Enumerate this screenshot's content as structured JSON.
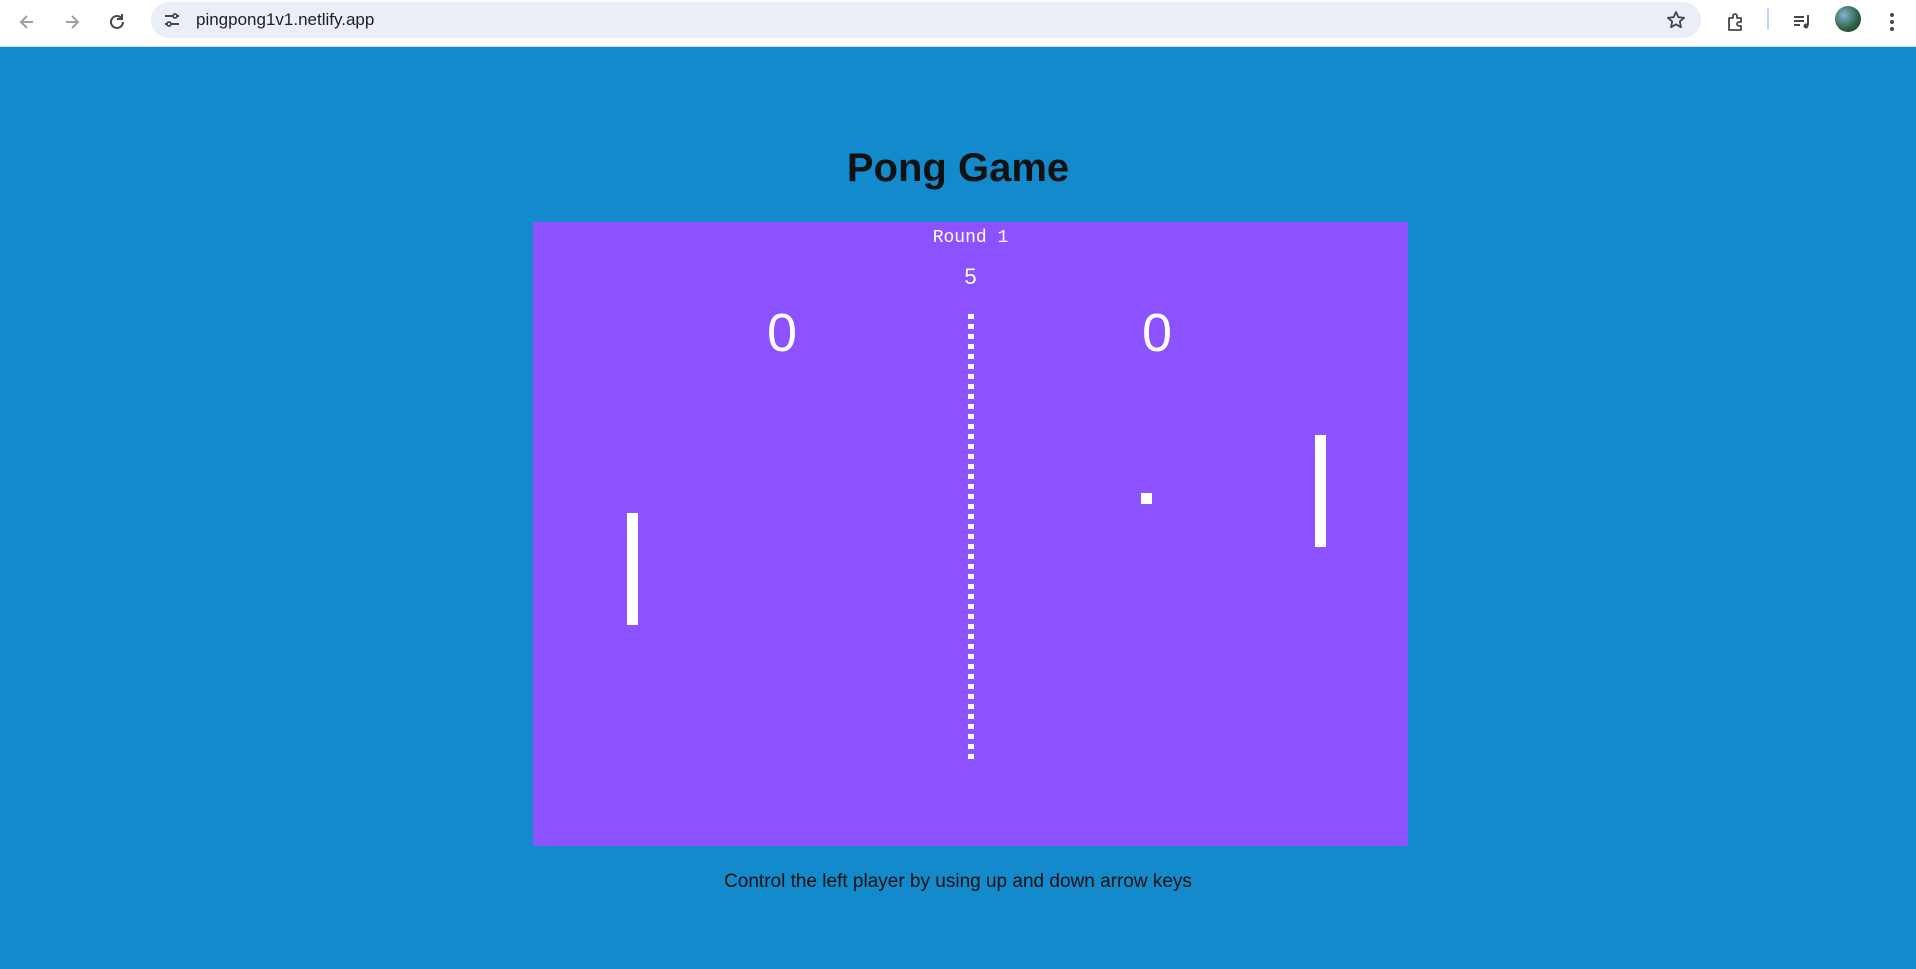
{
  "browser": {
    "url": "pingpong1v1.netlify.app",
    "icons": [
      "back-arrow-icon",
      "forward-arrow-icon",
      "reload-icon",
      "site-info-icon",
      "star-icon",
      "extensions-icon",
      "media-control-icon",
      "profile-avatar",
      "more-menu-icon"
    ]
  },
  "page": {
    "title": "Pong Game",
    "hint": "Control the left player by using up and down arrow keys"
  },
  "game": {
    "round": "Round 1",
    "timer": "5",
    "left_score": "0",
    "right_score": "0",
    "board_color": "#8c52ff",
    "background_color": "#138acb"
  }
}
